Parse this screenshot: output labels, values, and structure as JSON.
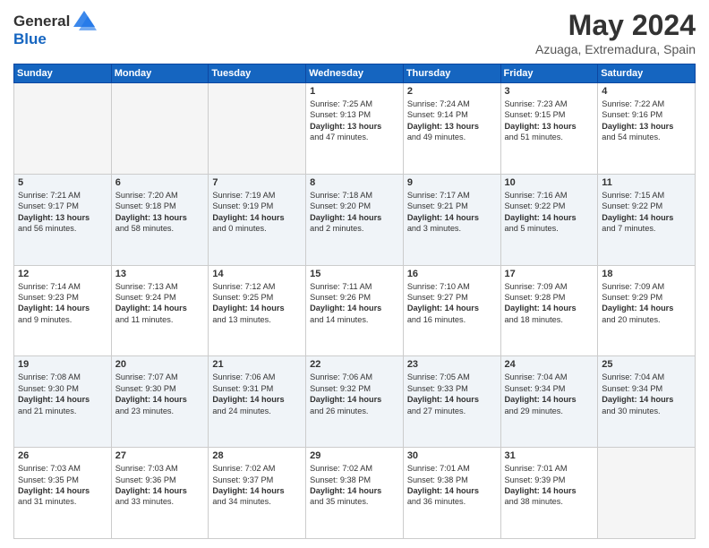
{
  "header": {
    "logo_line1": "General",
    "logo_line2": "Blue",
    "month_title": "May 2024",
    "location": "Azuaga, Extremadura, Spain"
  },
  "days_of_week": [
    "Sunday",
    "Monday",
    "Tuesday",
    "Wednesday",
    "Thursday",
    "Friday",
    "Saturday"
  ],
  "weeks": [
    {
      "alt": false,
      "days": [
        {
          "num": "",
          "info": ""
        },
        {
          "num": "",
          "info": ""
        },
        {
          "num": "",
          "info": ""
        },
        {
          "num": "1",
          "info": "Sunrise: 7:25 AM\nSunset: 9:13 PM\nDaylight: 13 hours\nand 47 minutes."
        },
        {
          "num": "2",
          "info": "Sunrise: 7:24 AM\nSunset: 9:14 PM\nDaylight: 13 hours\nand 49 minutes."
        },
        {
          "num": "3",
          "info": "Sunrise: 7:23 AM\nSunset: 9:15 PM\nDaylight: 13 hours\nand 51 minutes."
        },
        {
          "num": "4",
          "info": "Sunrise: 7:22 AM\nSunset: 9:16 PM\nDaylight: 13 hours\nand 54 minutes."
        }
      ]
    },
    {
      "alt": true,
      "days": [
        {
          "num": "5",
          "info": "Sunrise: 7:21 AM\nSunset: 9:17 PM\nDaylight: 13 hours\nand 56 minutes."
        },
        {
          "num": "6",
          "info": "Sunrise: 7:20 AM\nSunset: 9:18 PM\nDaylight: 13 hours\nand 58 minutes."
        },
        {
          "num": "7",
          "info": "Sunrise: 7:19 AM\nSunset: 9:19 PM\nDaylight: 14 hours\nand 0 minutes."
        },
        {
          "num": "8",
          "info": "Sunrise: 7:18 AM\nSunset: 9:20 PM\nDaylight: 14 hours\nand 2 minutes."
        },
        {
          "num": "9",
          "info": "Sunrise: 7:17 AM\nSunset: 9:21 PM\nDaylight: 14 hours\nand 3 minutes."
        },
        {
          "num": "10",
          "info": "Sunrise: 7:16 AM\nSunset: 9:22 PM\nDaylight: 14 hours\nand 5 minutes."
        },
        {
          "num": "11",
          "info": "Sunrise: 7:15 AM\nSunset: 9:22 PM\nDaylight: 14 hours\nand 7 minutes."
        }
      ]
    },
    {
      "alt": false,
      "days": [
        {
          "num": "12",
          "info": "Sunrise: 7:14 AM\nSunset: 9:23 PM\nDaylight: 14 hours\nand 9 minutes."
        },
        {
          "num": "13",
          "info": "Sunrise: 7:13 AM\nSunset: 9:24 PM\nDaylight: 14 hours\nand 11 minutes."
        },
        {
          "num": "14",
          "info": "Sunrise: 7:12 AM\nSunset: 9:25 PM\nDaylight: 14 hours\nand 13 minutes."
        },
        {
          "num": "15",
          "info": "Sunrise: 7:11 AM\nSunset: 9:26 PM\nDaylight: 14 hours\nand 14 minutes."
        },
        {
          "num": "16",
          "info": "Sunrise: 7:10 AM\nSunset: 9:27 PM\nDaylight: 14 hours\nand 16 minutes."
        },
        {
          "num": "17",
          "info": "Sunrise: 7:09 AM\nSunset: 9:28 PM\nDaylight: 14 hours\nand 18 minutes."
        },
        {
          "num": "18",
          "info": "Sunrise: 7:09 AM\nSunset: 9:29 PM\nDaylight: 14 hours\nand 20 minutes."
        }
      ]
    },
    {
      "alt": true,
      "days": [
        {
          "num": "19",
          "info": "Sunrise: 7:08 AM\nSunset: 9:30 PM\nDaylight: 14 hours\nand 21 minutes."
        },
        {
          "num": "20",
          "info": "Sunrise: 7:07 AM\nSunset: 9:30 PM\nDaylight: 14 hours\nand 23 minutes."
        },
        {
          "num": "21",
          "info": "Sunrise: 7:06 AM\nSunset: 9:31 PM\nDaylight: 14 hours\nand 24 minutes."
        },
        {
          "num": "22",
          "info": "Sunrise: 7:06 AM\nSunset: 9:32 PM\nDaylight: 14 hours\nand 26 minutes."
        },
        {
          "num": "23",
          "info": "Sunrise: 7:05 AM\nSunset: 9:33 PM\nDaylight: 14 hours\nand 27 minutes."
        },
        {
          "num": "24",
          "info": "Sunrise: 7:04 AM\nSunset: 9:34 PM\nDaylight: 14 hours\nand 29 minutes."
        },
        {
          "num": "25",
          "info": "Sunrise: 7:04 AM\nSunset: 9:34 PM\nDaylight: 14 hours\nand 30 minutes."
        }
      ]
    },
    {
      "alt": false,
      "days": [
        {
          "num": "26",
          "info": "Sunrise: 7:03 AM\nSunset: 9:35 PM\nDaylight: 14 hours\nand 31 minutes."
        },
        {
          "num": "27",
          "info": "Sunrise: 7:03 AM\nSunset: 9:36 PM\nDaylight: 14 hours\nand 33 minutes."
        },
        {
          "num": "28",
          "info": "Sunrise: 7:02 AM\nSunset: 9:37 PM\nDaylight: 14 hours\nand 34 minutes."
        },
        {
          "num": "29",
          "info": "Sunrise: 7:02 AM\nSunset: 9:38 PM\nDaylight: 14 hours\nand 35 minutes."
        },
        {
          "num": "30",
          "info": "Sunrise: 7:01 AM\nSunset: 9:38 PM\nDaylight: 14 hours\nand 36 minutes."
        },
        {
          "num": "31",
          "info": "Sunrise: 7:01 AM\nSunset: 9:39 PM\nDaylight: 14 hours\nand 38 minutes."
        },
        {
          "num": "",
          "info": ""
        }
      ]
    }
  ]
}
